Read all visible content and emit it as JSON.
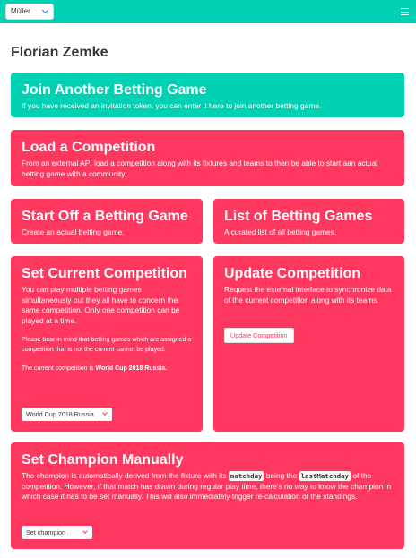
{
  "navbar": {
    "user_select": "Müller"
  },
  "page": {
    "title": "Florian Zemke"
  },
  "tiles": {
    "join": {
      "title": "Join Another Betting Game",
      "text": "If you have received an invitation token, you can enter it here to join another betting game."
    },
    "load": {
      "title": "Load a Competition",
      "text": "From an external API load a competition along with its fixtures and teams to then be able to start aan actual betting game with a community."
    },
    "start": {
      "title": "Start Off a Betting Game",
      "text": "Create an actual betting game."
    },
    "list": {
      "title": "List of Betting Games",
      "text": "A curated list of all betting games."
    },
    "current": {
      "title": "Set Current Competition",
      "text": "You can play multiple betting games simultaneously but they all have to concern the same competition. Only one competition can be played at a time.",
      "note": "Please bear in mind that betting games which are assigned a competition that is not the current cannot be played.",
      "current_prefix": "The current competition is ",
      "current_value": "World Cup 2018 Russia.",
      "select_value": "World Cup 2018 Russia"
    },
    "update": {
      "title": "Update Competition",
      "text": "Request the external interface to synchronize data of the current competition along with its teams.",
      "button": "Update Competition"
    },
    "champion": {
      "title": "Set Champion Manually",
      "text_1": "The champion is automatically derived from the fixture with its ",
      "code_1": "matchday",
      "text_2": " being the ",
      "code_2": "lastMatchday",
      "text_3": " of the competition. However, if that match has drawn during regular play time, there's no way to know the champion in which case it has to be set manually. This will also immediately trigger re-calculation of the standings.",
      "select_value": "Set champion"
    }
  },
  "colors": {
    "primary": "#00d1b2",
    "danger": "#ff3860"
  }
}
